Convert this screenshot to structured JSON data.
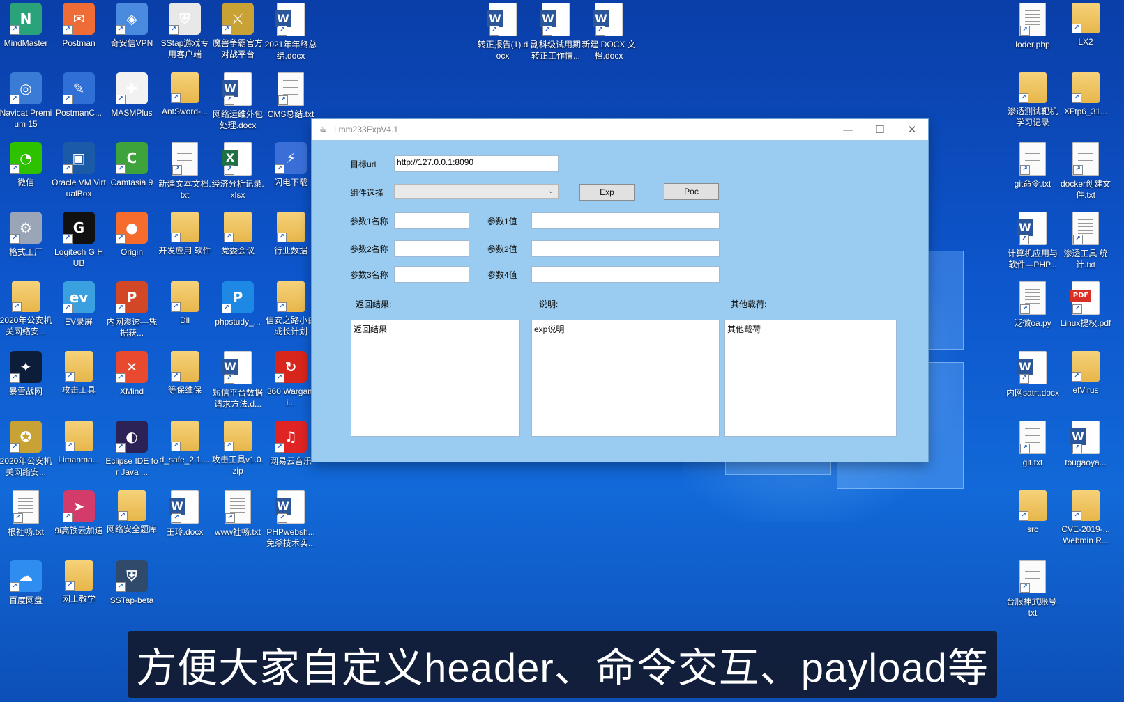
{
  "desktop": {
    "icons_left": [
      {
        "id": "mindmaster",
        "label": "MindMaster",
        "icon": "mindmaster-icon",
        "color": "#2aa37a",
        "glyph": "N",
        "type": "app"
      },
      {
        "id": "postman",
        "label": "Postman",
        "icon": "postman-icon",
        "color": "#ef6c36",
        "glyph": "✉",
        "type": "app"
      },
      {
        "id": "qianxin-vpn",
        "label": "奇安信VPN",
        "icon": "vpn-icon",
        "color": "#4a8be0",
        "glyph": "◈",
        "type": "app"
      },
      {
        "id": "sstap",
        "label": "SStap游戏专用客户端",
        "icon": "sstap-shield-icon",
        "color": "#e8e8e8",
        "glyph": "⛨",
        "type": "app"
      },
      {
        "id": "warcraft",
        "label": "魔兽争霸官方对战平台",
        "icon": "warcraft-icon",
        "color": "#c9a236",
        "glyph": "⚔",
        "type": "app"
      },
      {
        "id": "summary2021",
        "label": "2021年年终总结.docx",
        "icon": "word-doc-icon",
        "type": "word"
      },
      {
        "id": "navicat",
        "label": "Navicat Premium 15",
        "icon": "navicat-icon",
        "color": "#3a7bd5",
        "glyph": "◎",
        "type": "app"
      },
      {
        "id": "postmanc",
        "label": "PostmanC...",
        "icon": "postman-canary-icon",
        "color": "#2f6fd6",
        "glyph": "✎",
        "type": "app"
      },
      {
        "id": "masmplus",
        "label": "MASMPlus",
        "icon": "masmplus-icon",
        "color": "#f2f2f2",
        "glyph": "✚",
        "type": "app"
      },
      {
        "id": "antsword",
        "label": "AntSword-...",
        "icon": "zip-folder-icon",
        "type": "folder"
      },
      {
        "id": "network-ops",
        "label": "网络运维外包处理.docx",
        "icon": "word-doc-icon",
        "type": "word"
      },
      {
        "id": "cms-summary",
        "label": "CMS总结.txt",
        "icon": "text-file-icon",
        "type": "txt"
      },
      {
        "id": "wechat",
        "label": "微信",
        "icon": "wechat-icon",
        "color": "#2dc100",
        "glyph": "◔",
        "type": "app"
      },
      {
        "id": "virtualbox",
        "label": "Oracle VM VirtualBox",
        "icon": "virtualbox-icon",
        "color": "#1b5aa7",
        "glyph": "▣",
        "type": "app"
      },
      {
        "id": "camtasia",
        "label": "Camtasia 9",
        "icon": "camtasia-icon",
        "color": "#3ea33b",
        "glyph": "C",
        "type": "app"
      },
      {
        "id": "new-txt",
        "label": "新建文本文档.txt",
        "icon": "text-file-icon",
        "type": "txt"
      },
      {
        "id": "econ-xlsx",
        "label": "经济分析记录.xlsx",
        "icon": "excel-doc-icon",
        "type": "excel"
      },
      {
        "id": "flash-dl",
        "label": "闪电下载",
        "icon": "lightning-icon",
        "color": "#3b6fd8",
        "glyph": "⚡",
        "type": "app"
      },
      {
        "id": "format-factory",
        "label": "格式工厂",
        "icon": "format-factory-icon",
        "color": "#9aa6b8",
        "glyph": "⚙",
        "type": "app"
      },
      {
        "id": "logitech",
        "label": "Logitech G HUB",
        "icon": "logitech-icon",
        "color": "#111111",
        "glyph": "G",
        "type": "app"
      },
      {
        "id": "origin",
        "label": "Origin",
        "icon": "origin-icon",
        "color": "#f56c2d",
        "glyph": "●",
        "type": "app"
      },
      {
        "id": "dev-apps",
        "label": "开发应用 软件",
        "icon": "folder-icon",
        "type": "folder"
      },
      {
        "id": "party-meeting",
        "label": "党委会议",
        "icon": "folder-icon",
        "type": "folder"
      },
      {
        "id": "industry-data",
        "label": "行业数据",
        "icon": "folder-icon",
        "type": "folder"
      },
      {
        "id": "police2020a",
        "label": "2020年公安机关网络安...",
        "icon": "folder-icon",
        "type": "folder"
      },
      {
        "id": "ev-record",
        "label": "EV录屏",
        "icon": "ev-record-icon",
        "color": "#3aa0e0",
        "glyph": "ev",
        "type": "app"
      },
      {
        "id": "intranet-ppt",
        "label": "内网渗透—凭据获...",
        "icon": "ppt-doc-icon",
        "color": "#d24726",
        "glyph": "P",
        "type": "app"
      },
      {
        "id": "dll",
        "label": "Dll",
        "icon": "folder-icon",
        "type": "folder"
      },
      {
        "id": "phpstudy",
        "label": "phpstudy_...",
        "icon": "phpstudy-icon",
        "color": "#1e88e5",
        "glyph": "P",
        "type": "app"
      },
      {
        "id": "xinan-road",
        "label": "信安之路小白成长计划",
        "icon": "folder-icon",
        "type": "folder"
      },
      {
        "id": "baoxue",
        "label": "暴雪战网",
        "icon": "battlenet-icon",
        "color": "#0c1d3a",
        "glyph": "✦",
        "type": "app"
      },
      {
        "id": "attack-tools",
        "label": "攻击工具",
        "icon": "folder-icon",
        "type": "folder"
      },
      {
        "id": "xmind",
        "label": "XMind",
        "icon": "xmind-icon",
        "color": "#e8492f",
        "glyph": "✕",
        "type": "app"
      },
      {
        "id": "dengbao",
        "label": "等保维保",
        "icon": "folder-icon",
        "type": "folder"
      },
      {
        "id": "sms-platform",
        "label": "短信平台数据请求方法.d...",
        "icon": "word-doc-icon",
        "type": "word"
      },
      {
        "id": "wargaming",
        "label": "360 Wargami...",
        "icon": "wargaming-icon",
        "color": "#d9261c",
        "glyph": "↻",
        "type": "app"
      },
      {
        "id": "police2020b",
        "label": "2020年公安机关网络安...",
        "icon": "police-badge-icon",
        "color": "#c9a236",
        "glyph": "✪",
        "type": "app"
      },
      {
        "id": "limanma",
        "label": "Limanma...",
        "icon": "folder-icon",
        "type": "folder"
      },
      {
        "id": "eclipse",
        "label": "Eclipse IDE for Java ...",
        "icon": "eclipse-icon",
        "color": "#2c2255",
        "glyph": "◐",
        "type": "app"
      },
      {
        "id": "dsafe",
        "label": "d_safe_2.1....",
        "icon": "folder-icon",
        "type": "folder"
      },
      {
        "id": "attack-zip",
        "label": "攻击工具v1.0.zip",
        "icon": "zip-folder-icon",
        "type": "folder"
      },
      {
        "id": "netease-music",
        "label": "网易云音乐",
        "icon": "netease-music-icon",
        "color": "#e02424",
        "glyph": "♫",
        "type": "app"
      },
      {
        "id": "root-txt",
        "label": "根社畅.txt",
        "icon": "text-file-icon",
        "type": "txt"
      },
      {
        "id": "9hk",
        "label": "9i高铁云加速",
        "icon": "plane-icon",
        "color": "#d33b6a",
        "glyph": "➤",
        "type": "app"
      },
      {
        "id": "netsec-bank",
        "label": "网络安全题库",
        "icon": "folder-icon",
        "type": "folder"
      },
      {
        "id": "wangling",
        "label": "王玲.docx",
        "icon": "word-doc-icon",
        "type": "word"
      },
      {
        "id": "www-txt",
        "label": "www社畅.txt",
        "icon": "text-file-icon",
        "type": "txt"
      },
      {
        "id": "phpwebsh",
        "label": "PHPwebsh...免杀技术实...",
        "icon": "word-doc-icon",
        "type": "word"
      },
      {
        "id": "baidu-pan",
        "label": "百度网盘",
        "icon": "baidu-pan-icon",
        "color": "#2f8cf0",
        "glyph": "☁",
        "type": "app"
      },
      {
        "id": "net-teach",
        "label": "网上教学",
        "icon": "folder-icon",
        "type": "folder"
      },
      {
        "id": "sstap2",
        "label": "SSTap-beta",
        "icon": "sstap-shield-icon",
        "color": "#2f4a6a",
        "glyph": "⛨",
        "type": "app"
      }
    ],
    "icons_middle": [
      {
        "id": "zhuanzheng",
        "label": "转正报告(1).docx",
        "icon": "word-doc-icon",
        "type": "word"
      },
      {
        "id": "fuke",
        "label": "副科级试用期转正工作情...",
        "icon": "word-doc-icon",
        "type": "word"
      },
      {
        "id": "new-docx",
        "label": "新建 DOCX 文档.docx",
        "icon": "word-doc-icon",
        "type": "word"
      }
    ],
    "icons_right": [
      {
        "id": "loder",
        "label": "loder.php",
        "icon": "text-file-icon",
        "type": "txt"
      },
      {
        "id": "lx2",
        "label": "LX2",
        "icon": "folder-icon",
        "type": "folder"
      },
      {
        "id": "pentest-lab",
        "label": "渗透测试靶机学习记录",
        "icon": "zip-folder-icon",
        "type": "folder"
      },
      {
        "id": "xftp",
        "label": "XFtp6_31...",
        "icon": "folder-icon",
        "type": "folder"
      },
      {
        "id": "git-cmd",
        "label": "git命令.txt",
        "icon": "text-file-icon",
        "type": "txt"
      },
      {
        "id": "docker",
        "label": "docker创建文件.txt",
        "icon": "text-file-icon",
        "type": "txt"
      },
      {
        "id": "computer-app",
        "label": "计算机应用与软件---PHP...",
        "icon": "word-doc-icon",
        "type": "word"
      },
      {
        "id": "pentest-tools",
        "label": "渗透工具 统计.txt",
        "icon": "text-file-icon",
        "type": "txt"
      },
      {
        "id": "fanwei",
        "label": "泛微oa.py",
        "icon": "text-file-icon",
        "type": "txt"
      },
      {
        "id": "linux-pdf",
        "label": "Linux提权.pdf",
        "icon": "pdf-doc-icon",
        "type": "pdf"
      },
      {
        "id": "intranet-start",
        "label": "内网satrt.docx",
        "icon": "word-doc-icon",
        "type": "word"
      },
      {
        "id": "efvirus",
        "label": "efVirus",
        "icon": "zip-folder-icon",
        "type": "folder"
      },
      {
        "id": "git-txt",
        "label": "git.txt",
        "icon": "text-file-icon",
        "type": "txt"
      },
      {
        "id": "tougaoya",
        "label": "tougaoya...",
        "icon": "word-doc-icon",
        "type": "word"
      },
      {
        "id": "src",
        "label": "src",
        "icon": "folder-icon",
        "type": "folder"
      },
      {
        "id": "cve2019",
        "label": "CVE-2019-... Webmin R...",
        "icon": "zip-folder-icon",
        "type": "folder"
      },
      {
        "id": "taifu",
        "label": "台服神武账号.txt",
        "icon": "text-file-icon",
        "type": "txt"
      }
    ]
  },
  "window": {
    "title": "Lmm233ExpV4.1",
    "controls": {
      "minimize": "—",
      "maximize": "☐",
      "close": "✕"
    },
    "form": {
      "target_url_label": "目标url",
      "target_url_value": "http://127.0.0.1:8090",
      "component_label": "组件选择",
      "component_value": "",
      "exp_button": "Exp",
      "poc_button": "Poc",
      "param1_name_label": "参数1名称",
      "param1_value_label": "参数1值",
      "param2_name_label": "参数2名称",
      "param2_value_label": "参数2值",
      "param3_name_label": "参数3名称",
      "param4_value_label": "参数4值",
      "param1_name": "",
      "param1_value": "",
      "param2_name": "",
      "param2_value": "",
      "param3_name": "",
      "param4_value": "",
      "result_label": "返回结果:",
      "desc_label": "说明:",
      "payload_label": "其他载荷:",
      "result_text": "返回结果",
      "desc_text": "exp说明",
      "payload_text": "其他载荷"
    }
  },
  "caption": "方便大家自定义header、命令交互、payload等",
  "colors": {
    "window_bg": "#99ccf0",
    "caption_bg": "#14141e"
  }
}
